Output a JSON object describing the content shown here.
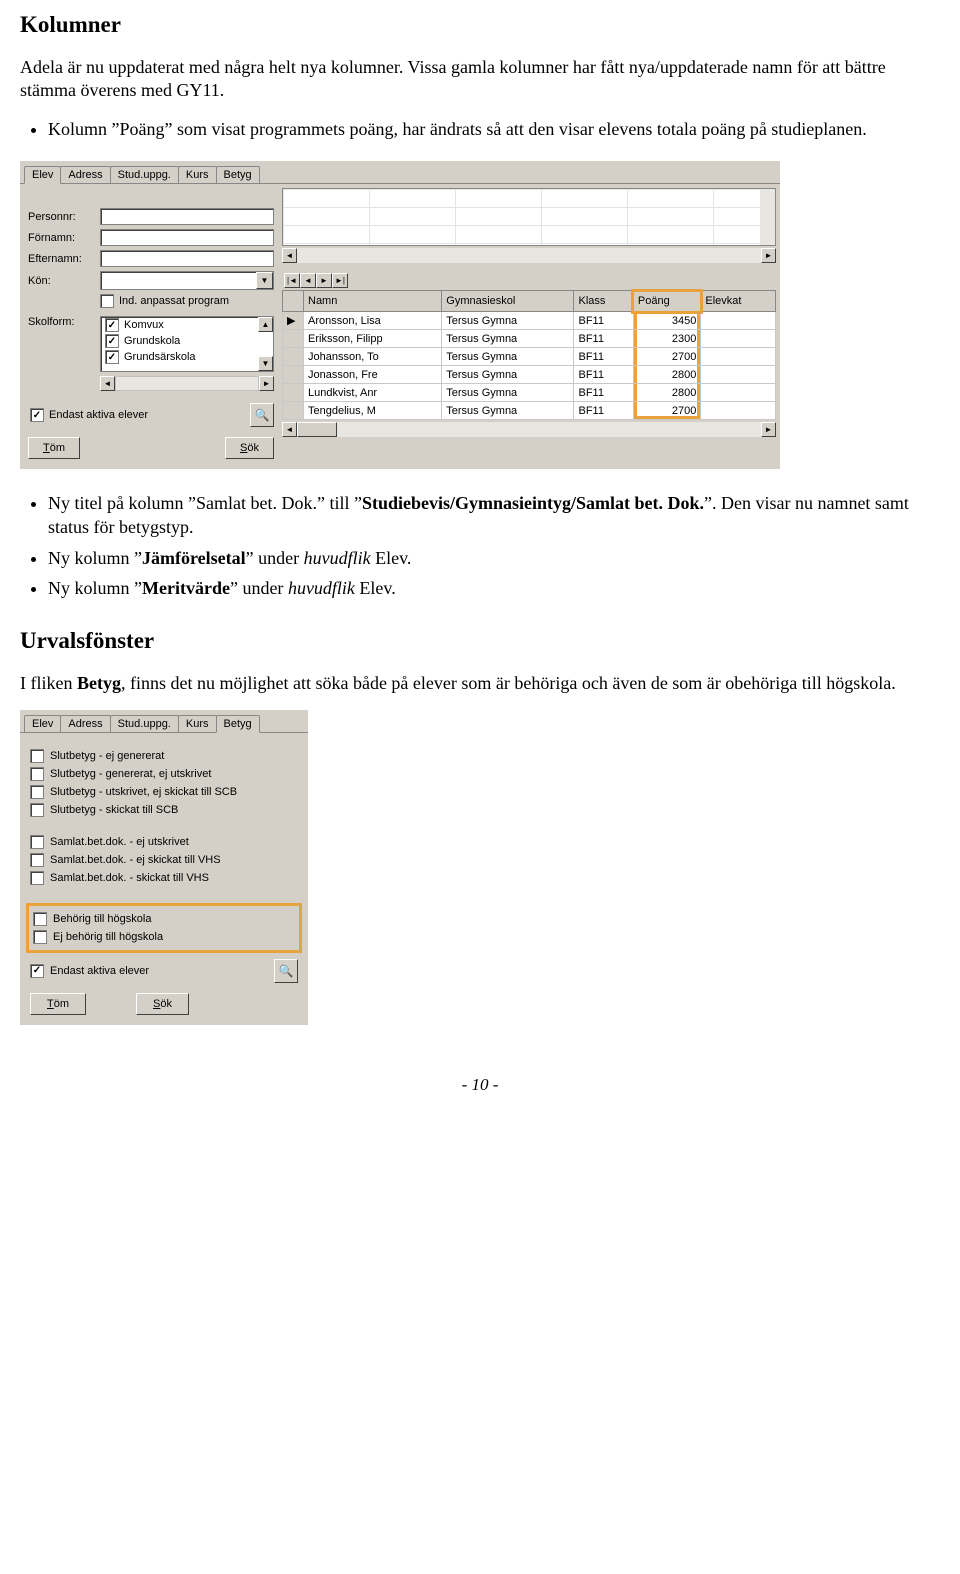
{
  "doc": {
    "h_kolumner": "Kolumner",
    "p_intro": "Adela är nu uppdaterat med några helt nya kolumner. Vissa gamla kolumner har fått nya/uppdaterade namn för att bättre stämma överens med GY11.",
    "bullet_poang": "Kolumn ”Poäng” som visat programmets poäng, har ändrats så att den visar elevens totala poäng på studieplanen.",
    "bullet_titel_a": "Ny titel på kolumn ”Samlat bet. Dok.” till ”",
    "bullet_titel_b": "Studiebevis/Gymnasieintyg/Samlat bet. Dok.",
    "bullet_titel_c": "”. Den visar nu namnet samt status för betygstyp.",
    "bullet_jam_a": "Ny kolumn ”",
    "bullet_jam_b": "Jämförelsetal",
    "bullet_jam_c": "” under ",
    "bullet_jam_d": "huvudflik",
    "bullet_jam_e": " Elev.",
    "bullet_merit_a": "Ny kolumn ”",
    "bullet_merit_b": "Meritvärde",
    "bullet_merit_c": "” under ",
    "bullet_merit_d": "huvudflik",
    "bullet_merit_e": " Elev.",
    "h_urval": "Urvalsfönster",
    "p_urval_a": "I fliken ",
    "p_urval_b": "Betyg",
    "p_urval_c": ", finns det nu möjlighet att söka både på elever som är behöriga och även de som är obehöriga till högskola.",
    "footer": "- 10 -"
  },
  "shot1": {
    "tabs": [
      "Elev",
      "Adress",
      "Stud.uppg.",
      "Kurs",
      "Betyg"
    ],
    "labels": {
      "personnr": "Personnr:",
      "fornamn": "Förnamn:",
      "efternamn": "Efternamn:",
      "kon": "Kön:",
      "ind": "Ind. anpassat program",
      "skolform": "Skolform:",
      "endast": "Endast aktiva elever"
    },
    "skolform_items": [
      "Komvux",
      "Grundskola",
      "Grundsärskola"
    ],
    "btn_tom": "öm",
    "btn_tom_u": "T",
    "btn_sok": "ök",
    "btn_sok_u": "S",
    "columns": [
      "Namn",
      "Gymnasieskol",
      "Klass",
      "Poäng",
      "Elevkat"
    ],
    "rows": [
      {
        "n": "Aronsson, Lisa",
        "g": "Tersus Gymna",
        "k": "BF11",
        "p": "3450"
      },
      {
        "n": "Eriksson, Filipp",
        "g": "Tersus Gymna",
        "k": "BF11",
        "p": "2300"
      },
      {
        "n": "Johansson, To",
        "g": "Tersus Gymna",
        "k": "BF11",
        "p": "2700"
      },
      {
        "n": "Jonasson, Fre",
        "g": "Tersus Gymna",
        "k": "BF11",
        "p": "2800"
      },
      {
        "n": "Lundkvist, Anr",
        "g": "Tersus Gymna",
        "k": "BF11",
        "p": "2800"
      },
      {
        "n": "Tengdelius, M",
        "g": "Tersus Gymna",
        "k": "BF11",
        "p": "2700"
      }
    ]
  },
  "shot2": {
    "tabs": [
      "Elev",
      "Adress",
      "Stud.uppg.",
      "Kurs",
      "Betyg"
    ],
    "items": [
      "Slutbetyg - ej genererat",
      "Slutbetyg - genererat, ej utskrivet",
      "Slutbetyg - utskrivet, ej skickat till SCB",
      "Slutbetyg - skickat till SCB"
    ],
    "items2": [
      "Samlat.bet.dok. - ej utskrivet",
      "Samlat.bet.dok. - ej skickat till VHS",
      "Samlat.bet.dok. - skickat till VHS"
    ],
    "hl": [
      "Behörig till högskola",
      "Ej behörig till högskola"
    ],
    "endast": "Endast aktiva elever",
    "btn_tom_u": "T",
    "btn_tom": "öm",
    "btn_sok_u": "S",
    "btn_sok": "ök"
  }
}
